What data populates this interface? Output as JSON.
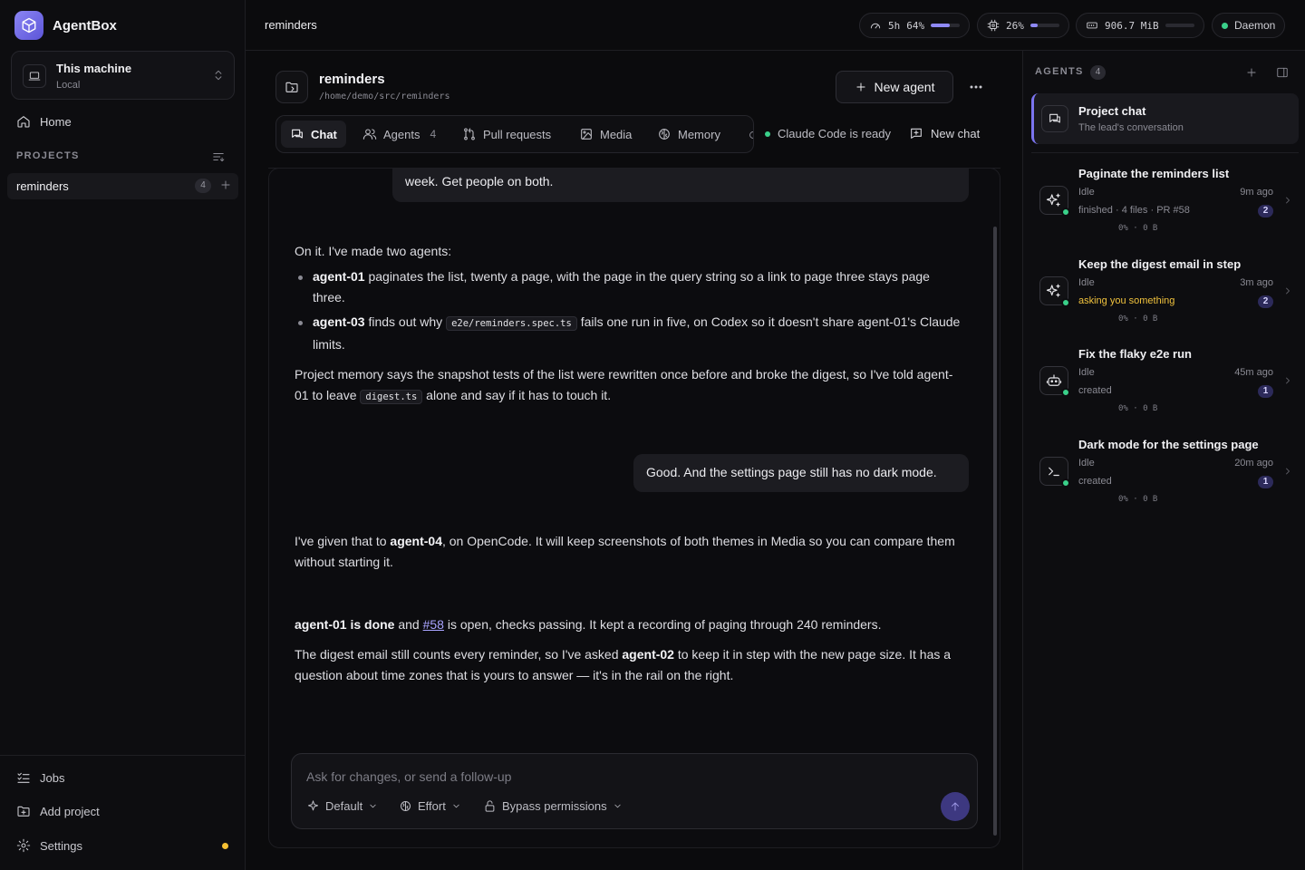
{
  "app": {
    "name": "AgentBox"
  },
  "machine": {
    "title": "This machine",
    "subtitle": "Local"
  },
  "nav": {
    "home": "Home"
  },
  "projects": {
    "heading": "PROJECTS",
    "items": [
      {
        "name": "reminders",
        "count": "4"
      }
    ]
  },
  "sidebar_bottom": {
    "jobs": "Jobs",
    "add_project": "Add project",
    "settings": "Settings"
  },
  "topbar": {
    "title": "reminders",
    "usage": {
      "label": "5h",
      "percent_text": "64%",
      "fill": 0.64
    },
    "cpu": {
      "percent_text": "26%",
      "fill": 0.26
    },
    "memory": {
      "value": "906.7 MiB",
      "fill": 0.0
    },
    "daemon": "Daemon"
  },
  "project": {
    "name": "reminders",
    "path": "/home/demo/src/reminders",
    "new_agent": "New agent"
  },
  "tabs": [
    {
      "label": "Chat",
      "active": true
    },
    {
      "label": "Agents",
      "count": "4"
    },
    {
      "label": "Pull requests"
    },
    {
      "label": "Media"
    },
    {
      "label": "Memory"
    }
  ],
  "status": {
    "ready": "Claude Code is ready",
    "new_chat": "New chat"
  },
  "chat": {
    "user1_tail": "week. Get people on both.",
    "a1_intro": "On it. I've made two agents:",
    "a1_b1": {
      "name": "agent-01",
      "text": " paginates the list, twenty a page, with the page in the query string so a link to page three stays page three."
    },
    "a1_b2": {
      "name": "agent-03",
      "pre": " finds out why ",
      "code": "e2e/reminders.spec.ts",
      "post": " fails one run in five, on Codex so it doesn't share agent-01's Claude limits."
    },
    "a1_memory": {
      "pre": "Project memory says the snapshot tests of the list were rewritten once before and broke the digest, so I've told agent-01 to leave ",
      "code": "digest.ts",
      "post": " alone and say if it has to touch it."
    },
    "user2": "Good. And the settings page still has no dark mode.",
    "a2": {
      "pre": "I've given that to ",
      "name": "agent-04",
      "post": ", on OpenCode. It will keep screenshots of both themes in Media so you can compare them without starting it."
    },
    "a3_p1": {
      "bold": "agent-01 is done",
      "mid": " and ",
      "link": "#58",
      "post": " is open, checks passing. It kept a recording of paging through 240 reminders."
    },
    "a3_p2": {
      "pre": "The digest email still counts every reminder, so I've asked ",
      "name": "agent-02",
      "post": " to keep it in step with the new page size. It has a question about time zones that is yours to answer — it's in the rail on the right."
    }
  },
  "composer": {
    "placeholder": "Ask for changes, or send a follow-up",
    "model": "Default",
    "effort": "Effort",
    "permissions": "Bypass permissions"
  },
  "rail": {
    "heading": "AGENTS",
    "count": "4",
    "project_chat": {
      "title": "Project chat",
      "subtitle": "The lead's conversation"
    },
    "agents": [
      {
        "title": "Paginate the reminders list",
        "state": "Idle",
        "time": "9m ago",
        "detail": "finished · 4 files · PR #58",
        "badge": "2",
        "meta": "0% · 0 B",
        "icon": "sparkle-icon",
        "warn": false
      },
      {
        "title": "Keep the digest email in step",
        "state": "Idle",
        "time": "3m ago",
        "detail": "asking you something",
        "badge": "2",
        "meta": "0% · 0 B",
        "icon": "sparkle-icon",
        "warn": true
      },
      {
        "title": "Fix the flaky e2e run",
        "state": "Idle",
        "time": "45m ago",
        "detail": "created",
        "badge": "1",
        "meta": "0% · 0 B",
        "icon": "robot-icon",
        "warn": false
      },
      {
        "title": "Dark mode for the settings page",
        "state": "Idle",
        "time": "20m ago",
        "detail": "created",
        "badge": "1",
        "meta": "0% · 0 B",
        "icon": "terminal-icon",
        "warn": false
      }
    ]
  },
  "colors": {
    "accent": "#7b74ef",
    "ready": "#3ad08a",
    "warn": "#f0c23d"
  }
}
